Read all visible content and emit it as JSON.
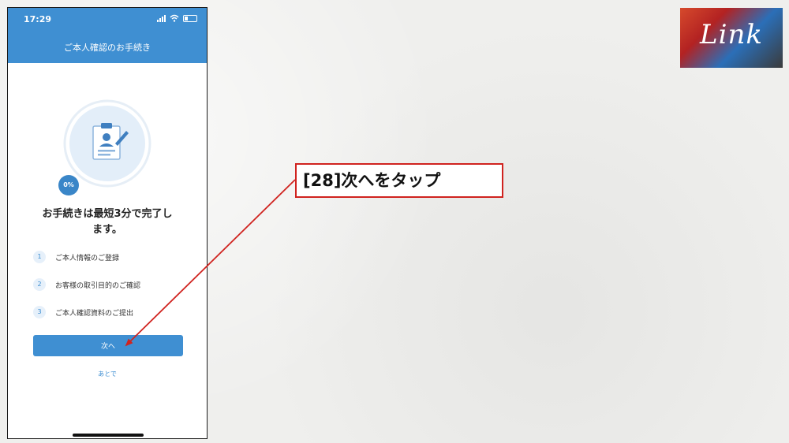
{
  "status_bar": {
    "time": "17:29"
  },
  "header": {
    "title": "ご本人確認のお手続き"
  },
  "progress": {
    "label": "0%",
    "value": 0
  },
  "main": {
    "title_line1": "お手続きは最短3分で完了し",
    "title_line2": "ます。"
  },
  "steps": [
    {
      "num": "1",
      "label": "ご本人情報のご登録"
    },
    {
      "num": "2",
      "label": "お客様の取引目的のご確認"
    },
    {
      "num": "3",
      "label": "ご本人確認資料のご提出"
    }
  ],
  "buttons": {
    "next": "次へ",
    "later": "あとで"
  },
  "annotation": {
    "text": "[28]次へをタップ"
  },
  "logo": {
    "text": "Link"
  },
  "colors": {
    "accent": "#3f8fd2",
    "annotation": "#d0231f"
  }
}
